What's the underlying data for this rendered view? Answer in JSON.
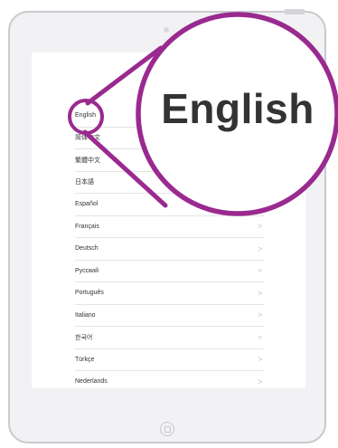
{
  "languages": [
    "English",
    "简体中文",
    "繁體中文",
    "日本語",
    "Español",
    "Français",
    "Deutsch",
    "Русский",
    "Português",
    "Italiano",
    "한국어",
    "Türkçe",
    "Nederlands"
  ],
  "chevron": ">",
  "magnified_label": "English",
  "colors": {
    "highlight": "#9a2a8f",
    "text": "#333333",
    "device_frame": "#c9c9cf"
  }
}
